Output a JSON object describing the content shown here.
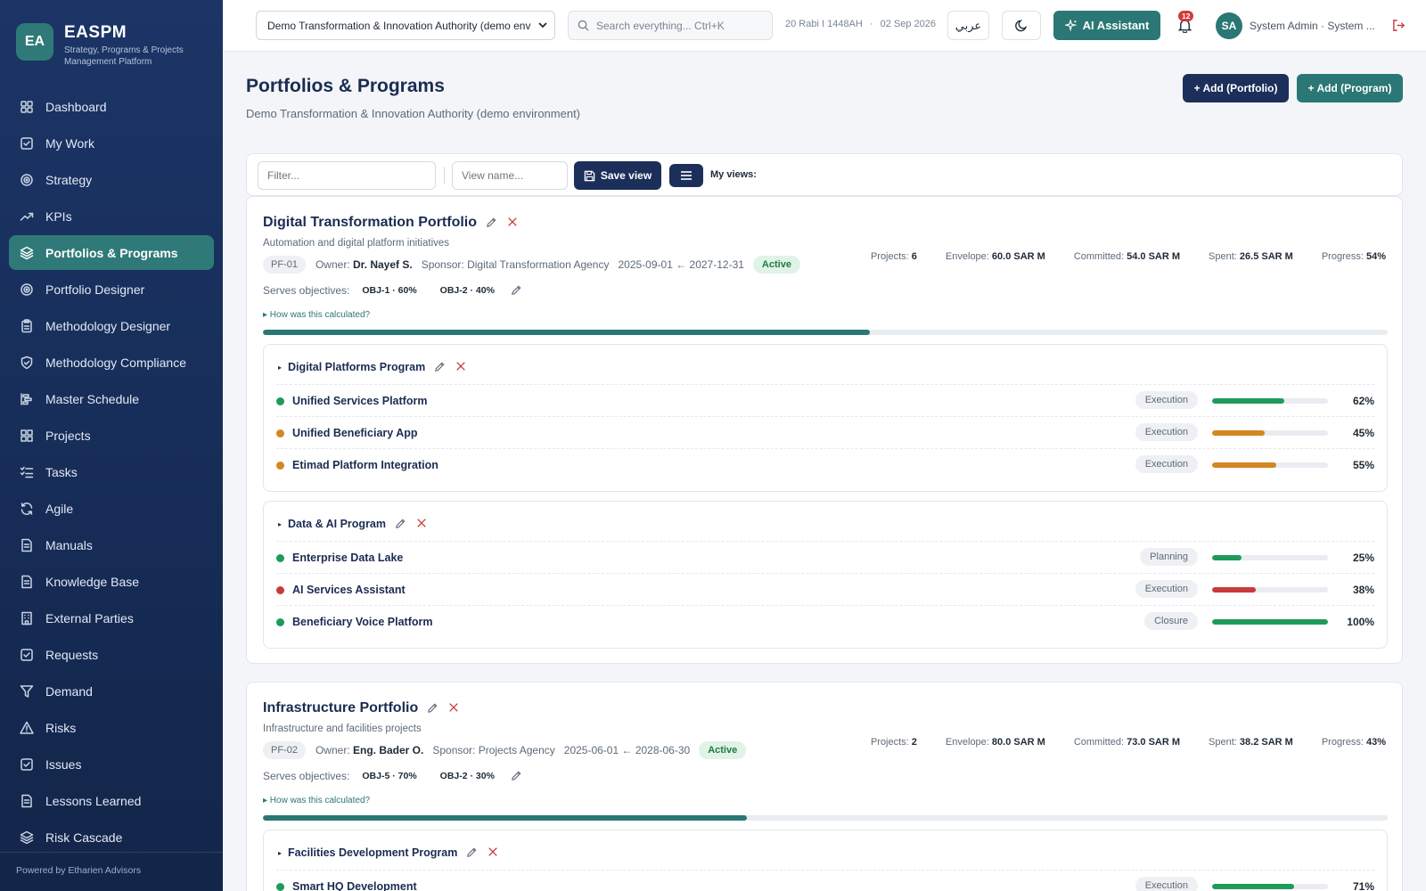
{
  "brand": {
    "logo_initials": "EA",
    "name": "EASPM",
    "subtitle": "Strategy, Programs & Projects Management Platform"
  },
  "sidebar": {
    "items": [
      {
        "label": "Dashboard",
        "icon": "dashboard-icon"
      },
      {
        "label": "My Work",
        "icon": "checkbox-icon"
      },
      {
        "label": "Strategy",
        "icon": "target-icon"
      },
      {
        "label": "KPIs",
        "icon": "trend-icon"
      },
      {
        "label": "Portfolios & Programs",
        "icon": "layers-icon",
        "active": true
      },
      {
        "label": "Portfolio Designer",
        "icon": "target-icon"
      },
      {
        "label": "Methodology Designer",
        "icon": "clipboard-icon"
      },
      {
        "label": "Methodology Compliance",
        "icon": "shield-icon"
      },
      {
        "label": "Master Schedule",
        "icon": "gantt-icon"
      },
      {
        "label": "Projects",
        "icon": "grid-icon"
      },
      {
        "label": "Tasks",
        "icon": "tasks-icon"
      },
      {
        "label": "Agile",
        "icon": "refresh-icon"
      },
      {
        "label": "Manuals",
        "icon": "document-icon"
      },
      {
        "label": "Knowledge Base",
        "icon": "document-icon"
      },
      {
        "label": "External Parties",
        "icon": "building-icon"
      },
      {
        "label": "Requests",
        "icon": "checkbox-icon"
      },
      {
        "label": "Demand",
        "icon": "funnel-icon"
      },
      {
        "label": "Risks",
        "icon": "warning-icon"
      },
      {
        "label": "Issues",
        "icon": "checkbox-icon"
      },
      {
        "label": "Lessons Learned",
        "icon": "document-icon"
      },
      {
        "label": "Risk Cascade",
        "icon": "layers-icon"
      }
    ],
    "footer": "Powered by Etharien Advisors"
  },
  "topbar": {
    "org_select_value": "Demo Transformation & Innovation Authority (demo env",
    "search_placeholder": "Search everything... Ctrl+K",
    "hijri_date": "20 Rabi I 1448AH",
    "date_separator": "·",
    "gregorian_date": "02 Sep 2026",
    "language_button": "عربي",
    "ai_button": "AI Assistant",
    "notification_count": "12",
    "user_initials": "SA",
    "user_label": "System Admin · System ..."
  },
  "page": {
    "title": "Portfolios & Programs",
    "subtitle": "Demo Transformation & Innovation Authority (demo environment)",
    "add_portfolio": "+ Add (Portfolio)",
    "add_program": "+ Add (Program)"
  },
  "toolbar": {
    "filter_placeholder": "Filter...",
    "view_name_placeholder": "View name...",
    "save_view": "Save view",
    "my_views": "My views:"
  },
  "labels": {
    "owner": "Owner:",
    "sponsor": "Sponsor:",
    "serves_objectives": "Serves objectives:",
    "calc_link": "How was this calculated?",
    "projects": "Projects:",
    "envelope": "Envelope:",
    "committed": "Committed:",
    "spent": "Spent:",
    "progress": "Progress:"
  },
  "colors": {
    "accent": "#2a7775",
    "navy": "#1c2f5a",
    "green": "#1f9a5a",
    "orange": "#d4861f",
    "red": "#c83a3a"
  },
  "portfolios": [
    {
      "title": "Digital Transformation Portfolio",
      "description": "Automation and digital platform initiatives",
      "code": "PF-01",
      "owner": "Dr. Nayef S.",
      "sponsor": "Digital Transformation Agency",
      "dates": "2025-09-01 ← 2027-12-31",
      "status": "Active",
      "stats": {
        "projects": "6",
        "envelope": "60.0 SAR M",
        "committed": "54.0 SAR M",
        "spent": "26.5 SAR M",
        "progress": "54%"
      },
      "progress_value": 54,
      "objectives": [
        "OBJ-1 · 60%",
        "OBJ-2 · 40%"
      ],
      "programs": [
        {
          "name": "Digital Platforms Program",
          "projects": [
            {
              "name": "Unified Services Platform",
              "phase": "Execution",
              "pct": "62%",
              "value": 62,
              "health": "green"
            },
            {
              "name": "Unified Beneficiary App",
              "phase": "Execution",
              "pct": "45%",
              "value": 45,
              "health": "orange"
            },
            {
              "name": "Etimad Platform Integration",
              "phase": "Execution",
              "pct": "55%",
              "value": 55,
              "health": "orange"
            }
          ]
        },
        {
          "name": "Data & AI Program",
          "projects": [
            {
              "name": "Enterprise Data Lake",
              "phase": "Planning",
              "pct": "25%",
              "value": 25,
              "health": "green"
            },
            {
              "name": "AI Services Assistant",
              "phase": "Execution",
              "pct": "38%",
              "value": 38,
              "health": "red"
            },
            {
              "name": "Beneficiary Voice Platform",
              "phase": "Closure",
              "pct": "100%",
              "value": 100,
              "health": "green"
            }
          ]
        }
      ]
    },
    {
      "title": "Infrastructure Portfolio",
      "description": "Infrastructure and facilities projects",
      "code": "PF-02",
      "owner": "Eng. Bader O.",
      "sponsor": "Projects Agency",
      "dates": "2025-06-01 ← 2028-06-30",
      "status": "Active",
      "stats": {
        "projects": "2",
        "envelope": "80.0 SAR M",
        "committed": "73.0 SAR M",
        "spent": "38.2 SAR M",
        "progress": "43%"
      },
      "progress_value": 43,
      "objectives": [
        "OBJ-5 · 70%",
        "OBJ-2 · 30%"
      ],
      "programs": [
        {
          "name": "Facilities Development Program",
          "projects": [
            {
              "name": "Smart HQ Development",
              "phase": "Execution",
              "pct": "71%",
              "value": 71,
              "health": "green"
            }
          ]
        }
      ]
    }
  ]
}
